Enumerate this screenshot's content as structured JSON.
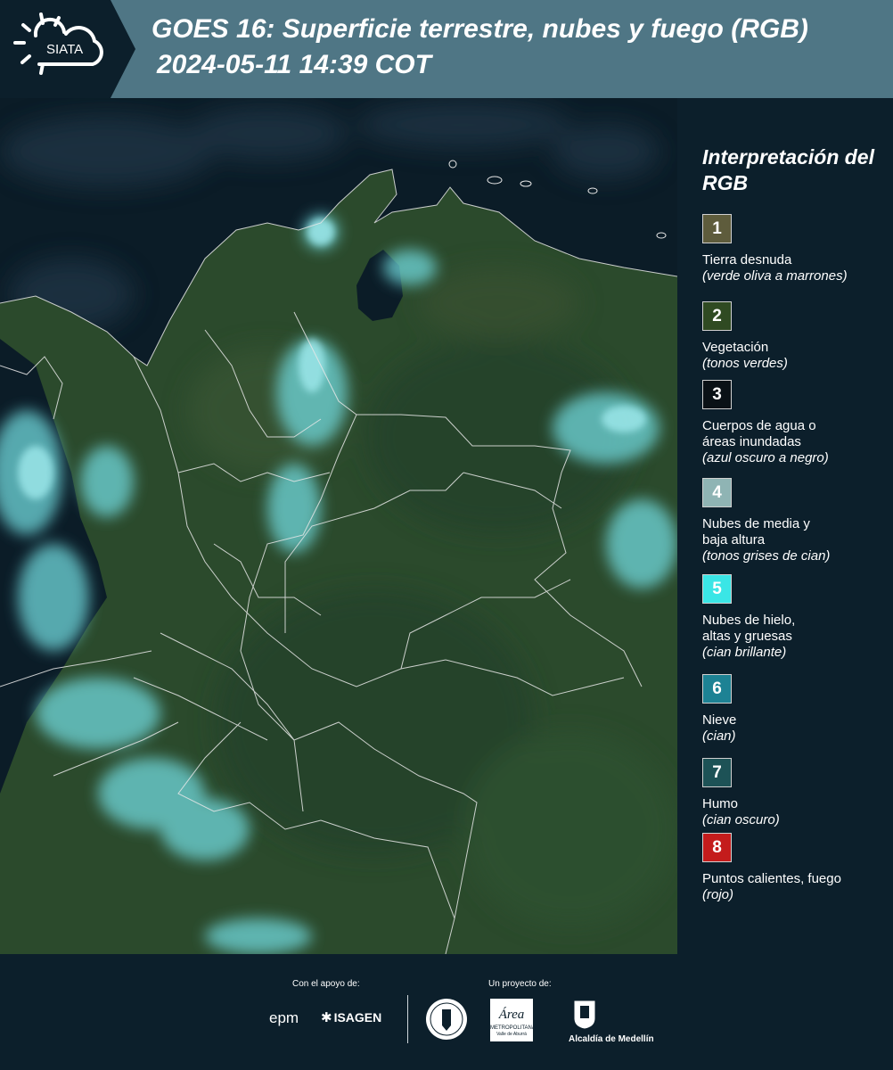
{
  "header": {
    "logo_text": "SIATA",
    "title": "GOES 16: Superficie terrestre, nubes y fuego (RGB)",
    "timestamp": "2024-05-11 14:39 COT"
  },
  "legend": {
    "title": "Interpretación del RGB",
    "items": [
      {
        "num": "1",
        "label": "Tierra desnuda",
        "desc": "(verde oliva a marrones)",
        "color": "#5e5c3c"
      },
      {
        "num": "2",
        "label": "Vegetación",
        "desc": "(tonos verdes)",
        "color": "#2f4a22"
      },
      {
        "num": "3",
        "label": "Cuerpos de agua o áreas inundadas",
        "desc": "(azul oscuro a negro)",
        "color": "#0a1116"
      },
      {
        "num": "4",
        "label": "Nubes de media y baja altura",
        "desc": "(tonos grises de cian)",
        "color": "#8fb4b4"
      },
      {
        "num": "5",
        "label": "Nubes de hielo, altas y gruesas",
        "desc": "(cian brillante)",
        "color": "#3ae6e6"
      },
      {
        "num": "6",
        "label": "Nieve",
        "desc": "(cian)",
        "color": "#1d8294"
      },
      {
        "num": "7",
        "label": "Humo",
        "desc": "(cian oscuro)",
        "color": "#1d5256"
      },
      {
        "num": "8",
        "label": "Puntos calientes, fuego",
        "desc": "(rojo)",
        "color": "#c41c1c"
      }
    ]
  },
  "footer": {
    "support_label": "Con el apoyo de:",
    "project_label": "Un proyecto de:",
    "epm": "epm",
    "isagen": "ISAGEN",
    "metro_logo": "Área",
    "metro_line1": "METROPOLITANA",
    "metro_line2": "Valle de Aburrá",
    "alcaldia": "Alcaldía de Medellín"
  },
  "colors": {
    "header_bg": "#4f7685",
    "page_bg": "#0c1f2b",
    "land": "#2b4a2c",
    "cloud": "#6fd8dc",
    "water": "#0b1c27"
  }
}
